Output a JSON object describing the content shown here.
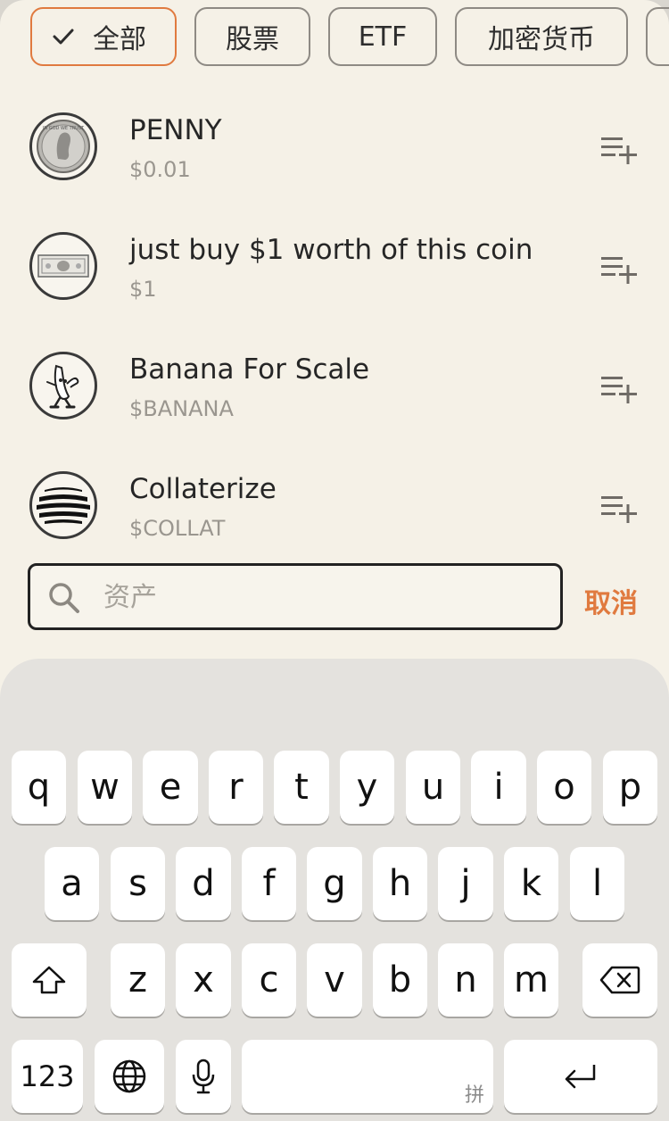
{
  "filters": {
    "chips": [
      "全部",
      "股票",
      "ETF",
      "加密货币",
      ""
    ],
    "active_index": 0
  },
  "assets": [
    {
      "name": "PENNY",
      "symbol": "$0.01",
      "icon": "penny-coin-icon"
    },
    {
      "name": "just buy $1 worth of this coin",
      "symbol": "$1",
      "icon": "dollar-bill-icon"
    },
    {
      "name": "Banana For Scale",
      "symbol": "$BANANA",
      "icon": "banana-mascot-icon"
    },
    {
      "name": "Collaterize",
      "symbol": "$COLLAT",
      "icon": "striped-globe-icon"
    }
  ],
  "search": {
    "placeholder": "资产",
    "cancel_label": "取消"
  },
  "keyboard": {
    "row1": [
      "q",
      "w",
      "e",
      "r",
      "t",
      "y",
      "u",
      "i",
      "o",
      "p"
    ],
    "row2": [
      "a",
      "s",
      "d",
      "f",
      "g",
      "h",
      "j",
      "k",
      "l"
    ],
    "row3": [
      "z",
      "x",
      "c",
      "v",
      "b",
      "n",
      "m"
    ],
    "numbers_label": "123",
    "space_hint": "拼"
  },
  "colors": {
    "accent": "#e07a3f",
    "background": "#f5f1e7",
    "keyboard": "#e4e2de"
  }
}
